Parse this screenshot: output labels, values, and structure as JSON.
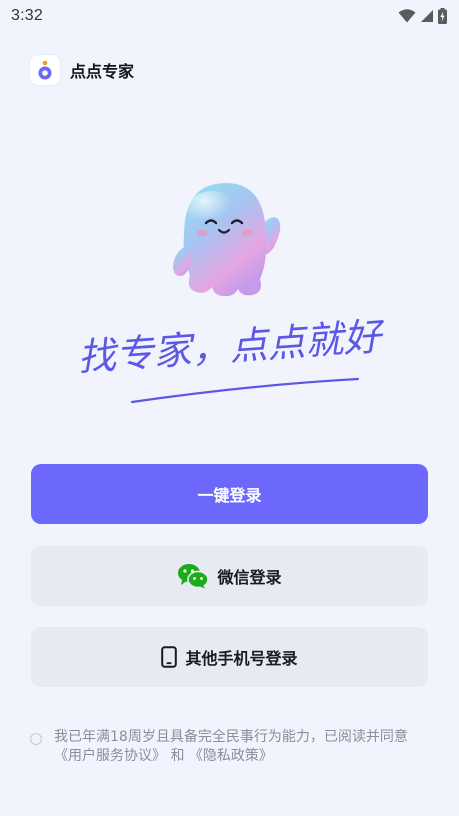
{
  "status_bar": {
    "time": "3:32",
    "icons": [
      "wifi-icon",
      "cellular-signal-icon",
      "battery-charging-icon"
    ]
  },
  "app": {
    "name": "点点专家",
    "logo": "dian-dian-logo"
  },
  "hero": {
    "mascot": "ghost-mascot-illustration",
    "slogan": "找专家，点点就好"
  },
  "buttons": {
    "one_click_login": "一键登录",
    "wechat_login": "微信登录",
    "wechat_icon": "wechat-icon",
    "other_phone_login": "其他手机号登录",
    "phone_icon": "mobile-phone-icon"
  },
  "agreement": {
    "checked": false,
    "text_prefix": "我已年满18周岁且具备完全民事行为能力，已阅读并同意",
    "user_agreement": "《用户服务协议》",
    "joiner": " 和 ",
    "privacy_policy": "《隐私政策》"
  },
  "colors": {
    "background": "#F2F4FD",
    "primary": "#6B68FB",
    "secondary_button": "#E7E9F3",
    "wechat_green": "#1AAD19",
    "muted_text": "#8A8D9B"
  }
}
